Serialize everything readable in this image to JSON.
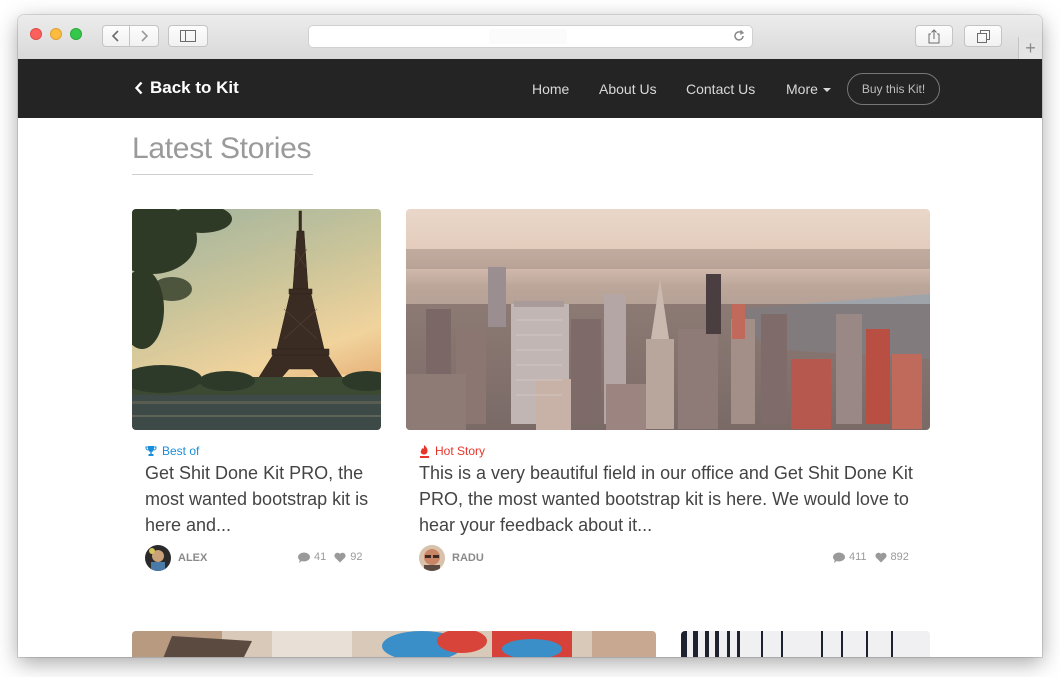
{
  "nav": {
    "brand": "Back to Kit",
    "links": [
      "Home",
      "About Us",
      "Contact Us",
      "More"
    ],
    "buy_label": "Buy this Kit!"
  },
  "section": {
    "title": "Latest Stories"
  },
  "cards": [
    {
      "tag": "Best of",
      "tag_color": "#1a8ed8",
      "title": "Get Shit Done Kit PRO, the most wanted bootstrap kit is here and...",
      "author": "ALEX",
      "comments": "41",
      "likes": "92"
    },
    {
      "tag": "Hot Story",
      "tag_color": "#e8352c",
      "title": "This is a very beautiful field in our office and Get Shit Done Kit PRO, the most wanted bootstrap kit is here. We would love to hear your feedback about it...",
      "author": "RADU",
      "comments": "411",
      "likes": "892"
    }
  ],
  "icons": {
    "trophy": "trophy-icon",
    "fire": "fire-icon",
    "comment": "comment-icon",
    "heart": "heart-icon"
  }
}
